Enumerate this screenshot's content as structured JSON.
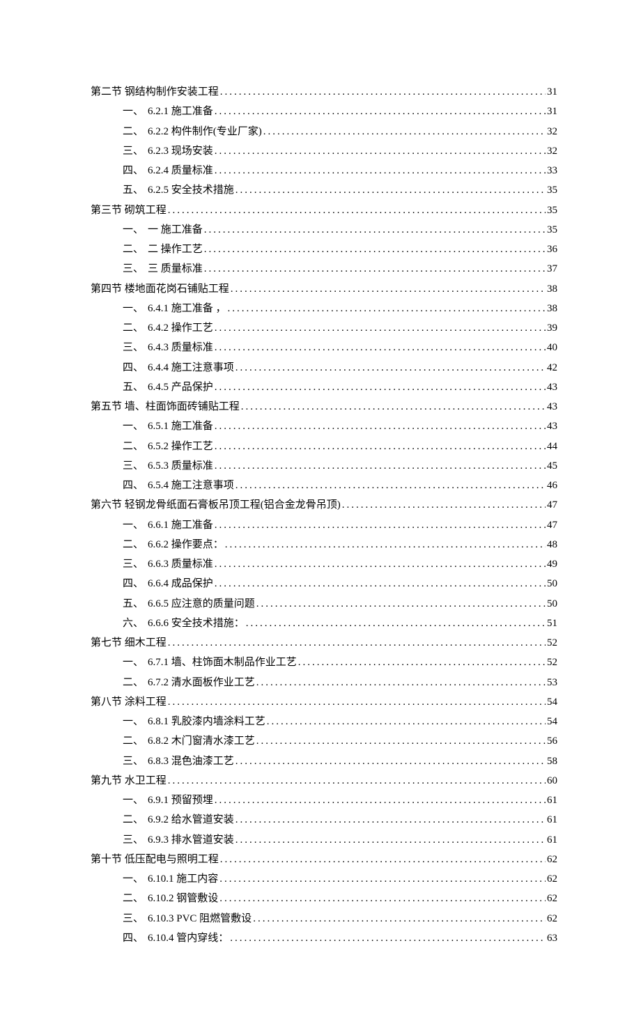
{
  "entries": [
    {
      "level": 0,
      "prefix": "第二节",
      "title": "钢结构制作安装工程",
      "page": "31"
    },
    {
      "level": 1,
      "prefix": "一、",
      "title": "6.2.1 施工准备",
      "page": "31"
    },
    {
      "level": 1,
      "prefix": "二、",
      "title": "6.2.2 构件制作(专业厂家)",
      "page": "32"
    },
    {
      "level": 1,
      "prefix": "三、",
      "title": "6.2.3  现场安装",
      "page": "32"
    },
    {
      "level": 1,
      "prefix": "四、",
      "title": "6.2.4 质量标准",
      "page": "33"
    },
    {
      "level": 1,
      "prefix": "五、",
      "title": "6.2.5  安全技术措施",
      "page": "35"
    },
    {
      "level": 0,
      "prefix": "第三节",
      "title": "砌筑工程",
      "page": "35"
    },
    {
      "level": 1,
      "prefix": "一、",
      "title": "一 施工准备",
      "page": "35"
    },
    {
      "level": 1,
      "prefix": "二、",
      "title": "二 操作工艺",
      "page": "36"
    },
    {
      "level": 1,
      "prefix": "三、",
      "title": "三 质量标准",
      "page": "37"
    },
    {
      "level": 0,
      "prefix": "第四节",
      "title": "楼地面花岗石铺贴工程",
      "page": "38"
    },
    {
      "level": 1,
      "prefix": "一、",
      "title": "6.4.1 施工准备  ，",
      "page": "38"
    },
    {
      "level": 1,
      "prefix": "二、",
      "title": "6.4.2 操作工艺",
      "page": "39"
    },
    {
      "level": 1,
      "prefix": "三、",
      "title": "6.4.3 质量标准",
      "page": "40"
    },
    {
      "level": 1,
      "prefix": "四、",
      "title": "6.4.4 施工注意事项",
      "page": "42"
    },
    {
      "level": 1,
      "prefix": "五、",
      "title": "6.4.5 产品保护",
      "page": "43"
    },
    {
      "level": 0,
      "prefix": "第五节",
      "title": "墙、柱面饰面砖铺贴工程",
      "page": "43"
    },
    {
      "level": 1,
      "prefix": "一、",
      "title": "6.5.1 施工准备",
      "page": "43"
    },
    {
      "level": 1,
      "prefix": "二、",
      "title": "6.5.2 操作工艺",
      "page": "44"
    },
    {
      "level": 1,
      "prefix": "三、",
      "title": "6.5.3 质量标准",
      "page": "45"
    },
    {
      "level": 1,
      "prefix": "四、",
      "title": "6.5.4 施工注意事项",
      "page": "46"
    },
    {
      "level": 0,
      "prefix": "第六节",
      "title": "轻钢龙骨纸面石膏板吊顶工程(铝合金龙骨吊顶)",
      "page": "47"
    },
    {
      "level": 1,
      "prefix": "一、",
      "title": "6.6.1 施工准备",
      "page": "47"
    },
    {
      "level": 1,
      "prefix": "二、",
      "title": "6.6.2 操作要点：",
      "page": "48"
    },
    {
      "level": 1,
      "prefix": "三、",
      "title": "6.6.3 质量标准",
      "page": "49"
    },
    {
      "level": 1,
      "prefix": "四、",
      "title": "6.6.4 成品保护",
      "page": "50"
    },
    {
      "level": 1,
      "prefix": "五、",
      "title": "6.6.5 应注意的质量问题",
      "page": "50"
    },
    {
      "level": 1,
      "prefix": "六、",
      "title": "6.6.6 安全技术措施：",
      "page": "51"
    },
    {
      "level": 0,
      "prefix": "第七节",
      "title": "细木工程",
      "page": "52"
    },
    {
      "level": 1,
      "prefix": "一、",
      "title": "6.7.1 墙、柱饰面木制品作业工艺",
      "page": "52"
    },
    {
      "level": 1,
      "prefix": "二、",
      "title": "6.7.2 清水面板作业工艺",
      "page": "53"
    },
    {
      "level": 0,
      "prefix": "第八节",
      "title": "涂料工程",
      "page": "54"
    },
    {
      "level": 1,
      "prefix": "一、",
      "title": "6.8.1 乳胶漆内墙涂料工艺",
      "page": "54"
    },
    {
      "level": 1,
      "prefix": "二、",
      "title": "6.8.2 木门窗清水漆工艺",
      "page": "56"
    },
    {
      "level": 1,
      "prefix": "三、",
      "title": "6.8.3  混色油漆工艺",
      "page": "58"
    },
    {
      "level": 0,
      "prefix": "第九节",
      "title": "水卫工程",
      "page": "60"
    },
    {
      "level": 1,
      "prefix": "一、",
      "title": "6.9.1 预留预埋",
      "page": "61"
    },
    {
      "level": 1,
      "prefix": "二、",
      "title": "6.9.2 给水管道安装",
      "page": "61"
    },
    {
      "level": 1,
      "prefix": "三、",
      "title": "6.9.3 排水管道安装",
      "page": "61"
    },
    {
      "level": 0,
      "prefix": "第十节",
      "title": "低压配电与照明工程",
      "page": "62"
    },
    {
      "level": 1,
      "prefix": "一、",
      "title": "6.10.1 施工内容",
      "page": "62"
    },
    {
      "level": 1,
      "prefix": "二、",
      "title": "6.10.2 钢管敷设",
      "page": "62"
    },
    {
      "level": 1,
      "prefix": "三、",
      "title": "6.10.3 PVC 阻燃管敷设",
      "page": "62"
    },
    {
      "level": 1,
      "prefix": "四、",
      "title": "6.10.4 管内穿线：",
      "page": "63"
    }
  ]
}
